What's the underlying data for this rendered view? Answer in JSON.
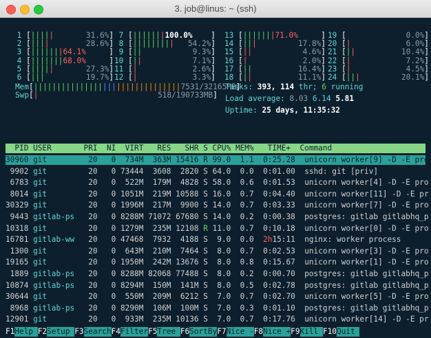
{
  "window": {
    "title": "3. job@linus: ~ (ssh)"
  },
  "cpus": [
    {
      "num": "1",
      "bar": [
        [
          "c-green",
          "||||"
        ],
        [
          "c-red",
          "|"
        ]
      ],
      "pct": "31.6%"
    },
    {
      "num": "2",
      "bar": [
        [
          "c-green",
          "|||"
        ],
        [
          "c-red",
          "|"
        ]
      ],
      "pct": "28.6%"
    },
    {
      "num": "3",
      "bar": [
        [
          "c-green",
          "||||||"
        ],
        [
          "c-red",
          "|64.1%"
        ]
      ],
      "pct": ""
    },
    {
      "num": "4",
      "bar": [
        [
          "c-green",
          "|||||||"
        ],
        [
          "c-red",
          "68.0%"
        ]
      ],
      "pct": ""
    },
    {
      "num": "5",
      "bar": [
        [
          "c-green",
          "||||"
        ],
        [
          "c-red",
          "|"
        ]
      ],
      "pct": "27.3%"
    },
    {
      "num": "6",
      "bar": [
        [
          "c-green",
          "|||"
        ]
      ],
      "pct": "19.7%"
    },
    {
      "num": "7",
      "bar": [
        [
          "c-green",
          "||||||"
        ],
        [
          "c-red",
          "|"
        ],
        [
          "c-white",
          "100.0%"
        ]
      ],
      "pct": ""
    },
    {
      "num": "8",
      "bar": [
        [
          "c-green",
          "||||||||"
        ],
        [
          "c-red",
          "|"
        ]
      ],
      "pct": "54.2%"
    },
    {
      "num": "9",
      "bar": [
        [
          "c-green",
          "||"
        ]
      ],
      "pct": "9.3%"
    },
    {
      "num": "10",
      "bar": [
        [
          "c-green",
          "|"
        ],
        [
          "c-red",
          "|"
        ]
      ],
      "pct": "7.1%"
    },
    {
      "num": "11",
      "bar": [
        [
          "c-red",
          "|"
        ]
      ],
      "pct": "2.6%"
    },
    {
      "num": "12",
      "bar": [
        [
          "c-red",
          "|"
        ]
      ],
      "pct": "3.3%"
    },
    {
      "num": "13",
      "bar": [
        [
          "c-green",
          "||||||"
        ],
        [
          "c-red",
          "|71.0%"
        ]
      ],
      "pct": ""
    },
    {
      "num": "14",
      "bar": [
        [
          "c-green",
          "||"
        ],
        [
          "c-red",
          "|"
        ]
      ],
      "pct": "17.8%"
    },
    {
      "num": "15",
      "bar": [
        [
          "c-red",
          "||"
        ]
      ],
      "pct": "4.6%"
    },
    {
      "num": "16",
      "bar": [
        [
          "c-red",
          "|"
        ]
      ],
      "pct": "2.0%"
    },
    {
      "num": "17",
      "bar": [
        [
          "c-green",
          "||"
        ]
      ],
      "pct": "16.4%"
    },
    {
      "num": "18",
      "bar": [
        [
          "c-green",
          "|"
        ],
        [
          "c-red",
          "|"
        ]
      ],
      "pct": "11.1%"
    },
    {
      "num": "19",
      "bar": [],
      "pct": "0.0%"
    },
    {
      "num": "20",
      "bar": [
        [
          "c-red",
          "|"
        ]
      ],
      "pct": "6.0%"
    },
    {
      "num": "21",
      "bar": [
        [
          "c-green",
          "|"
        ],
        [
          "c-red",
          "|"
        ]
      ],
      "pct": "10.4%"
    },
    {
      "num": "22",
      "bar": [
        [
          "c-red",
          "|"
        ]
      ],
      "pct": "7.2%"
    },
    {
      "num": "23",
      "bar": [
        [
          "c-red",
          "|"
        ]
      ],
      "pct": "4.5%"
    },
    {
      "num": "24",
      "bar": [
        [
          "c-green",
          "||"
        ],
        [
          "c-red",
          "|"
        ]
      ],
      "pct": "20.1%"
    }
  ],
  "mem": {
    "label": "Mem",
    "value": "7531/32165MB"
  },
  "swp": {
    "label": "Swp",
    "value": "518/190733MB"
  },
  "tasks": {
    "label": "Tasks:",
    "count": "393,",
    "thr": "114",
    "thr_label": "thr;",
    "running": "6",
    "running_label": "running"
  },
  "load": {
    "label": "Load average:",
    "v1": "8.03",
    "v2": "6.14",
    "v3": "5.81"
  },
  "uptime": {
    "label": "Uptime:",
    "value": "25 days, 11:35:32"
  },
  "columns": "  PID USER       PRI  NI  VIRT   RES   SHR S CPU% MEM%   TIME+  Command",
  "processes": [
    {
      "pid": "30960",
      "user": "git",
      "pri": "20",
      "ni": "0",
      "virt": "734M",
      "res": "363M",
      "shr": "15416",
      "s": "R",
      "cpu": "99.0",
      "mem": "1.1",
      "time": "0:25.28",
      "cmd": "unicorn worker[9] -D -E pro"
    },
    {
      "pid": "9902",
      "user": "git",
      "pri": "20",
      "ni": "0",
      "virt": "73444",
      "res": "3608",
      "shr": "2820",
      "s": "S",
      "cpu": "64.0",
      "mem": "0.0",
      "time": "0:01.00",
      "cmd": "sshd: git [priv]"
    },
    {
      "pid": "6783",
      "user": "git",
      "pri": "20",
      "ni": "0",
      "virt": "522M",
      "res": "179M",
      "shr": "4828",
      "s": "S",
      "cpu": "58.0",
      "mem": "0.6",
      "time": "0:01.53",
      "cmd": "unicorn worker[4] -D -E pro"
    },
    {
      "pid": "8014",
      "user": "git",
      "pri": "20",
      "ni": "0",
      "virt": "1051M",
      "res": "219M",
      "shr": "10588",
      "s": "S",
      "cpu": "16.0",
      "mem": "0.7",
      "time": "0:04.40",
      "cmd": "unicorn worker[11] -D -E pr"
    },
    {
      "pid": "30329",
      "user": "git",
      "pri": "20",
      "ni": "0",
      "virt": "1996M",
      "res": "217M",
      "shr": "9900",
      "s": "S",
      "cpu": "14.0",
      "mem": "0.7",
      "time": "0:03.33",
      "cmd": "unicorn worker[7] -D -E pro"
    },
    {
      "pid": "9443",
      "user": "gitlab-ps",
      "pri": "20",
      "ni": "0",
      "virt": "8288M",
      "res": "71072",
      "shr": "67680",
      "s": "S",
      "cpu": "14.0",
      "mem": "0.2",
      "time": "0:00.38",
      "cmd": "postgres: gitlab gitlabhq_p"
    },
    {
      "pid": "10318",
      "user": "git",
      "pri": "20",
      "ni": "0",
      "virt": "1279M",
      "res": "235M",
      "shr": "12108",
      "s": "R",
      "cpu": "11.0",
      "mem": "0.7",
      "time": "0:10.18",
      "cmd": "unicorn worker[0] -D -E pro"
    },
    {
      "pid": "16781",
      "user": "gitlab-ww",
      "pri": "20",
      "ni": "0",
      "virt": "47468",
      "res": "7932",
      "shr": "4188",
      "s": "S",
      "cpu": "9.0",
      "mem": "0.0",
      "time": "2h15:11",
      "cmd": "nginx: worker process"
    },
    {
      "pid": "1300",
      "user": "git",
      "pri": "20",
      "ni": "0",
      "virt": "643M",
      "res": "210M",
      "shr": "7464",
      "s": "S",
      "cpu": "8.0",
      "mem": "0.7",
      "time": "0:02.53",
      "cmd": "unicorn worker[3] -D -E pro"
    },
    {
      "pid": "19165",
      "user": "git",
      "pri": "20",
      "ni": "0",
      "virt": "1950M",
      "res": "242M",
      "shr": "13676",
      "s": "S",
      "cpu": "8.0",
      "mem": "0.8",
      "time": "0:15.67",
      "cmd": "unicorn worker[1] -D -E pro"
    },
    {
      "pid": "1889",
      "user": "gitlab-ps",
      "pri": "20",
      "ni": "0",
      "virt": "8288M",
      "res": "82068",
      "shr": "77488",
      "s": "S",
      "cpu": "8.0",
      "mem": "0.2",
      "time": "0:00.70",
      "cmd": "postgres: gitlab gitlabhq_p"
    },
    {
      "pid": "10874",
      "user": "gitlab-ps",
      "pri": "20",
      "ni": "0",
      "virt": "8294M",
      "res": "150M",
      "shr": "141M",
      "s": "S",
      "cpu": "8.0",
      "mem": "0.5",
      "time": "0:02.78",
      "cmd": "postgres: gitlab gitlabhq_p"
    },
    {
      "pid": "30644",
      "user": "git",
      "pri": "20",
      "ni": "0",
      "virt": "550M",
      "res": "209M",
      "shr": "6212",
      "s": "S",
      "cpu": "7.0",
      "mem": "0.7",
      "time": "0:02.70",
      "cmd": "unicorn worker[5] -D -E pro"
    },
    {
      "pid": "8968",
      "user": "gitlab-ps",
      "pri": "20",
      "ni": "0",
      "virt": "8290M",
      "res": "106M",
      "shr": "100M",
      "s": "S",
      "cpu": "7.0",
      "mem": "0.3",
      "time": "0:01.10",
      "cmd": "postgres: gitlab gitlabhq_p"
    },
    {
      "pid": "12901",
      "user": "git",
      "pri": "20",
      "ni": "0",
      "virt": "933M",
      "res": "235M",
      "shr": "10136",
      "s": "S",
      "cpu": "7.0",
      "mem": "0.7",
      "time": "0:17.76",
      "cmd": "unicorn worker[14] -D -E pr"
    }
  ],
  "fkeys": [
    {
      "key": "F1",
      "label": "Help"
    },
    {
      "key": "F2",
      "label": "Setup"
    },
    {
      "key": "F3",
      "label": "Search"
    },
    {
      "key": "F4",
      "label": "Filter"
    },
    {
      "key": "F5",
      "label": "Tree"
    },
    {
      "key": "F6",
      "label": "SortBy"
    },
    {
      "key": "F7",
      "label": "Nice -"
    },
    {
      "key": "F8",
      "label": "Nice +"
    },
    {
      "key": "F9",
      "label": "Kill"
    },
    {
      "key": "F10",
      "label": "Quit"
    }
  ]
}
